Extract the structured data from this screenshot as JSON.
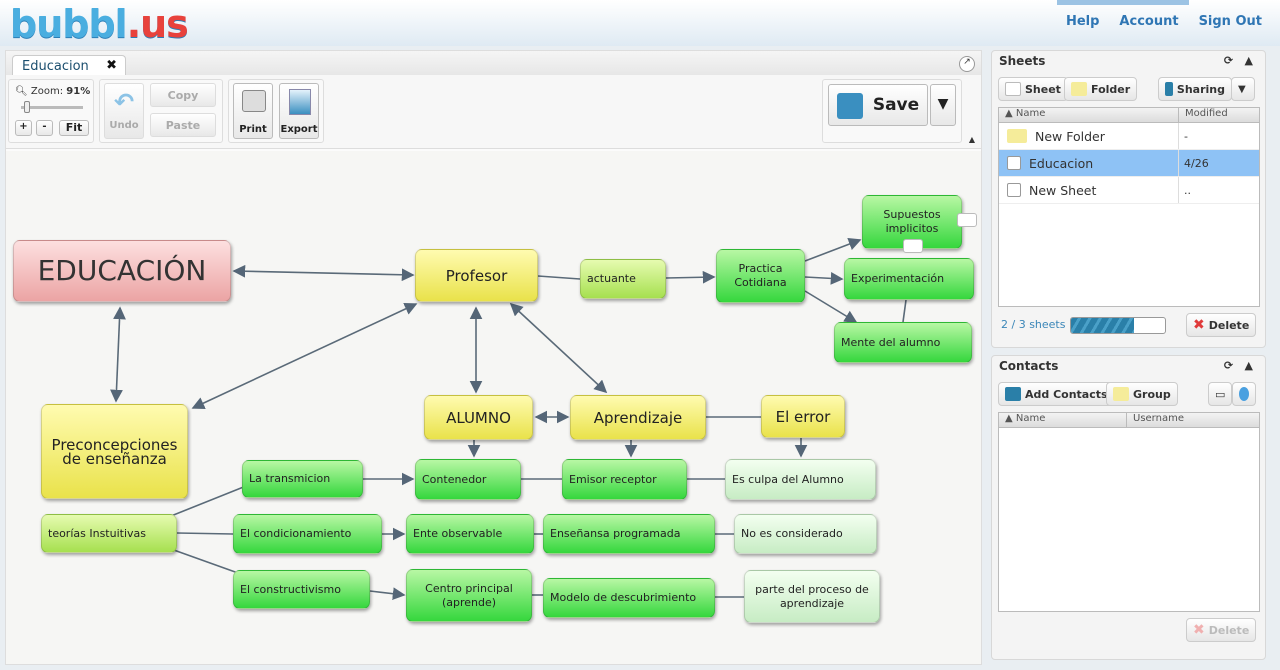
{
  "header": {
    "logo_text": "bubbl",
    "logo_suffix": ".us",
    "links": [
      "Help",
      "Account",
      "Sign Out"
    ]
  },
  "tab": {
    "label": "Educacion",
    "close": "✖"
  },
  "toolbar": {
    "zoom_label": "Zoom:",
    "zoom_value": "91%",
    "zoom_in": "+",
    "zoom_out": "-",
    "fit": "Fit",
    "undo": "Undo",
    "copy": "Copy",
    "paste": "Paste",
    "print": "Print",
    "export": "Export",
    "save": "Save"
  },
  "map": {
    "nodes": [
      "EDUCACIÓN",
      "Profesor",
      "actuante",
      "Practica Cotidiana",
      "Supuestos implicitos",
      "Experimentación",
      "Mente del alumno",
      "Preconcepciones de enseñanza",
      "ALUMNO",
      "Aprendizaje",
      "El error",
      "La transmicion",
      "Contenedor",
      "Emisor receptor",
      "Es culpa del Alumno",
      "teorías Instuitivas",
      "El condicionamiento",
      "Ente observable",
      "Enseñansa programada",
      "No es considerado",
      "El constructivismo",
      "Centro principal (aprende)",
      "Modelo de descubrimiento",
      "parte del proceso de aprendizaje"
    ]
  },
  "sheets": {
    "title": "Sheets",
    "sheet_btn": "Sheet",
    "folder_btn": "Folder",
    "sharing_btn": "Sharing",
    "col_name": "Name",
    "col_modified": "Modified",
    "rows": [
      {
        "name": "New Folder",
        "modified": "-",
        "type": "folder"
      },
      {
        "name": "Educacion",
        "modified": "4/26",
        "type": "sheet",
        "selected": true
      },
      {
        "name": "New Sheet",
        "modified": "..",
        "type": "sheet"
      }
    ],
    "count": "2 / 3 sheets",
    "usage_percent": 67,
    "delete": "Delete"
  },
  "contacts": {
    "title": "Contacts",
    "add_btn": "Add Contacts",
    "group_btn": "Group",
    "col_name": "Name",
    "col_username": "Username",
    "delete": "Delete"
  },
  "colors": {
    "accent": "#2f76b4",
    "selection": "#8ec2f5",
    "root": "#eba4a4",
    "yellow": "#e9e24a",
    "green": "#35d73d"
  }
}
